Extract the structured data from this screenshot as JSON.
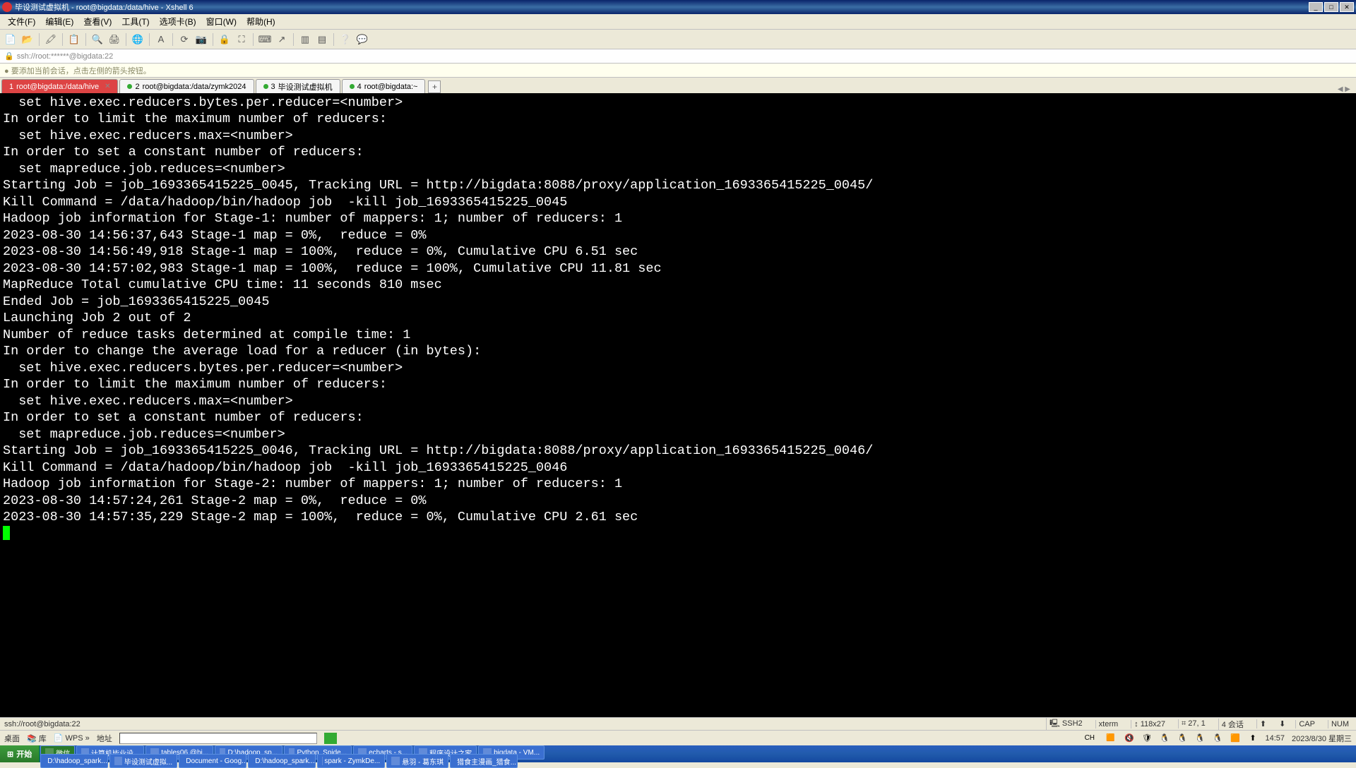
{
  "title": "毕设测试虚拟机 - root@bigdata:/data/hive - Xshell 6",
  "menus": [
    "文件(F)",
    "编辑(E)",
    "查看(V)",
    "工具(T)",
    "选项卡(B)",
    "窗口(W)",
    "帮助(H)"
  ],
  "address": "ssh://root:******@bigdata:22",
  "hint": "● 要添加当前会话，点击左侧的箭头按钮。",
  "tabs": [
    {
      "num": "1",
      "label": "root@bigdata:/data/hive",
      "active": true
    },
    {
      "num": "2",
      "label": "root@bigdata:/data/zymk2024",
      "active": false
    },
    {
      "num": "3",
      "label": "毕设测试虚拟机",
      "active": false
    },
    {
      "num": "4",
      "label": "root@bigdata:~",
      "active": false
    }
  ],
  "term_lines": [
    "  set hive.exec.reducers.bytes.per.reducer=<number>",
    "In order to limit the maximum number of reducers:",
    "  set hive.exec.reducers.max=<number>",
    "In order to set a constant number of reducers:",
    "  set mapreduce.job.reduces=<number>",
    "Starting Job = job_1693365415225_0045, Tracking URL = http://bigdata:8088/proxy/application_1693365415225_0045/",
    "Kill Command = /data/hadoop/bin/hadoop job  -kill job_1693365415225_0045",
    "Hadoop job information for Stage-1: number of mappers: 1; number of reducers: 1",
    "2023-08-30 14:56:37,643 Stage-1 map = 0%,  reduce = 0%",
    "2023-08-30 14:56:49,918 Stage-1 map = 100%,  reduce = 0%, Cumulative CPU 6.51 sec",
    "2023-08-30 14:57:02,983 Stage-1 map = 100%,  reduce = 100%, Cumulative CPU 11.81 sec",
    "MapReduce Total cumulative CPU time: 11 seconds 810 msec",
    "Ended Job = job_1693365415225_0045",
    "Launching Job 2 out of 2",
    "Number of reduce tasks determined at compile time: 1",
    "In order to change the average load for a reducer (in bytes):",
    "  set hive.exec.reducers.bytes.per.reducer=<number>",
    "In order to limit the maximum number of reducers:",
    "  set hive.exec.reducers.max=<number>",
    "In order to set a constant number of reducers:",
    "  set mapreduce.job.reduces=<number>",
    "Starting Job = job_1693365415225_0046, Tracking URL = http://bigdata:8088/proxy/application_1693365415225_0046/",
    "Kill Command = /data/hadoop/bin/hadoop job  -kill job_1693365415225_0046",
    "Hadoop job information for Stage-2: number of mappers: 1; number of reducers: 1",
    "2023-08-30 14:57:24,261 Stage-2 map = 0%,  reduce = 0%",
    "2023-08-30 14:57:35,229 Stage-2 map = 100%,  reduce = 0%, Cumulative CPU 2.61 sec"
  ],
  "status": {
    "conn": "ssh://root@bigdata:22",
    "proto": "SSH2",
    "term": "xterm",
    "size": "↕ 118x27",
    "pos": "⌗ 27, 1",
    "sessions": "4 会话",
    "cap": "CAP",
    "num": "NUM"
  },
  "desktop": {
    "label1": "桌面",
    "label2": "库",
    "wps": "WPS",
    "addr_label": "地址",
    "ime_ch": "CH",
    "ime_s": "S",
    "time": "14:57",
    "date": "2023/8/30 星期三"
  },
  "taskbar": {
    "start": "开始",
    "buttons": [
      "微信",
      "计算机毕业设...",
      "tables06 @hi...",
      "D:\\hadoop_sp...",
      "Python_Spide...",
      "echarts - s...",
      "程序设计之家",
      "bigdata - VM..."
    ],
    "buttons2": [
      "D:\\hadoop_spark...",
      "毕设测试虚拟...",
      "Document - Goog...",
      "D:\\hadoop_spark...",
      "spark - ZymkDe...",
      "悬羽 - 葛东琪",
      "猎食主漫画_猎食..."
    ]
  }
}
